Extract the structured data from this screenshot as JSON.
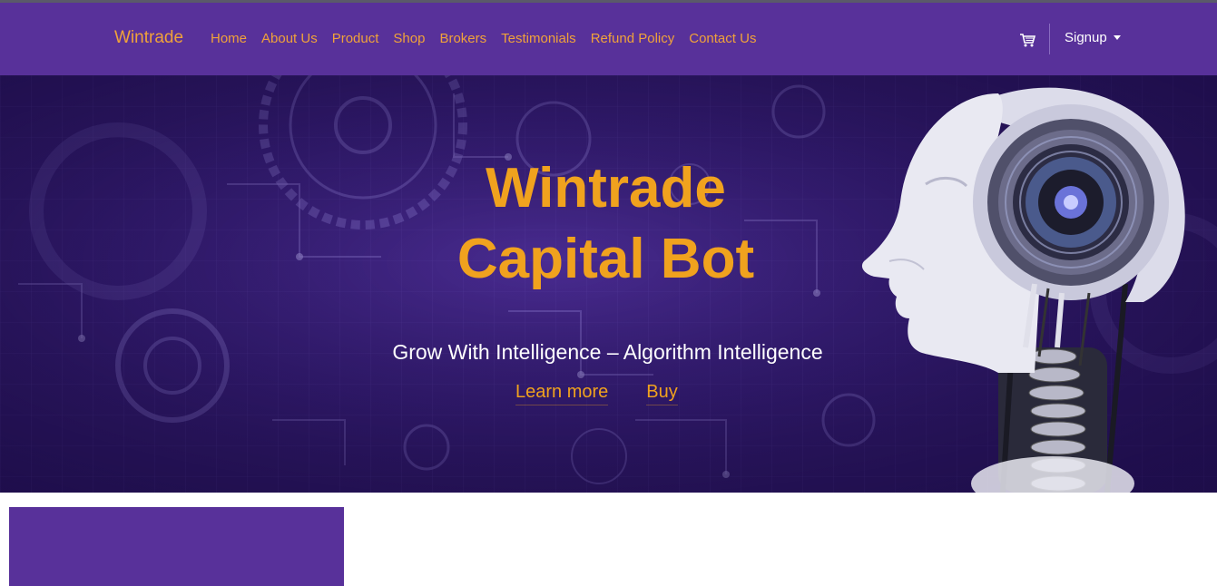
{
  "navbar": {
    "brand": "Wintrade",
    "links": [
      "Home",
      "About Us",
      "Product",
      "Shop",
      "Brokers",
      "Testimonials",
      "Refund Policy",
      "Contact Us"
    ],
    "cart_icon": "cart-icon",
    "signup_label": "Signup"
  },
  "hero": {
    "title_line1": "Wintrade",
    "title_line2": "Capital Bot",
    "subtitle": "Grow With Intelligence – Algorithm Intelligence",
    "learn_more_label": "Learn more",
    "buy_label": "Buy"
  },
  "colors": {
    "nav_bg": "#58319a",
    "accent": "#f0a21e",
    "hero_bg": "#3a1f80"
  }
}
